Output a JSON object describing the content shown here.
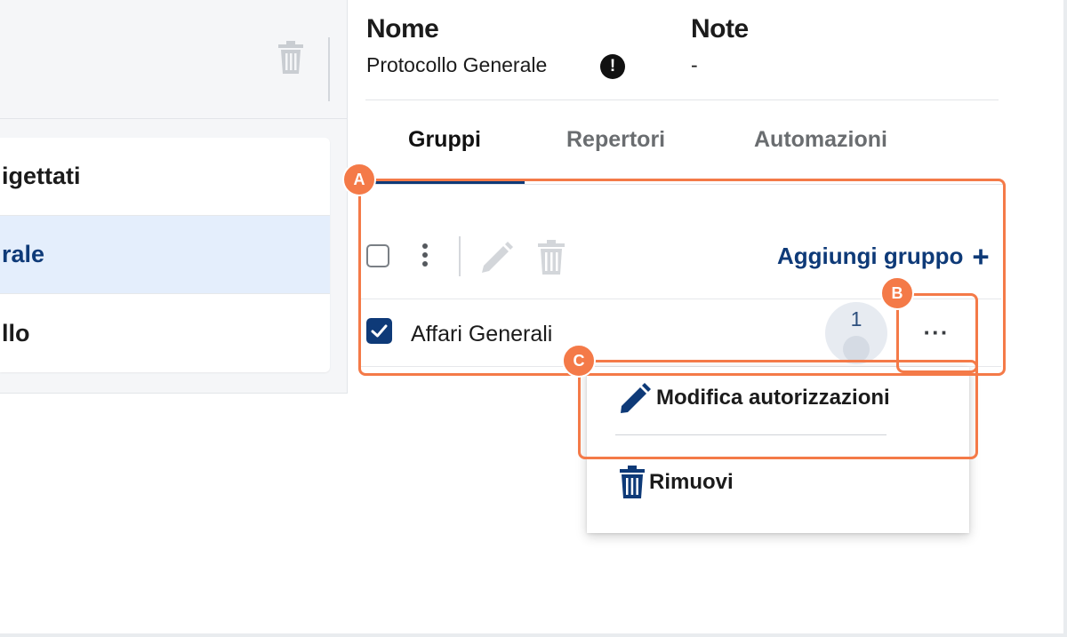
{
  "left_panel": {
    "list_items": [
      {
        "label": "igettati"
      },
      {
        "label": "rale"
      },
      {
        "label": "llo"
      }
    ]
  },
  "header": {
    "name_label": "Nome",
    "name_value": "Protocollo Generale",
    "notes_label": "Note",
    "notes_value": "-",
    "info_icon": "!"
  },
  "tabs": [
    {
      "label": "Gruppi"
    },
    {
      "label": "Repertori"
    },
    {
      "label": "Automazioni"
    }
  ],
  "toolbar": {
    "add_group_label": "Aggiungi gruppo",
    "add_icon": "+"
  },
  "groups": [
    {
      "name": "Affari Generali",
      "count": "1",
      "more": "···"
    }
  ],
  "context_menu": {
    "items": [
      {
        "label": "Modifica autorizzazioni",
        "icon": "pencil-icon"
      },
      {
        "label": "Rimuovi",
        "icon": "trash-icon"
      }
    ]
  },
  "annotations": {
    "markers": [
      "A",
      "B",
      "C"
    ]
  },
  "colors": {
    "primary": "#0e3a78",
    "callout": "#f47a48",
    "selected_bg": "#e4eefc"
  }
}
